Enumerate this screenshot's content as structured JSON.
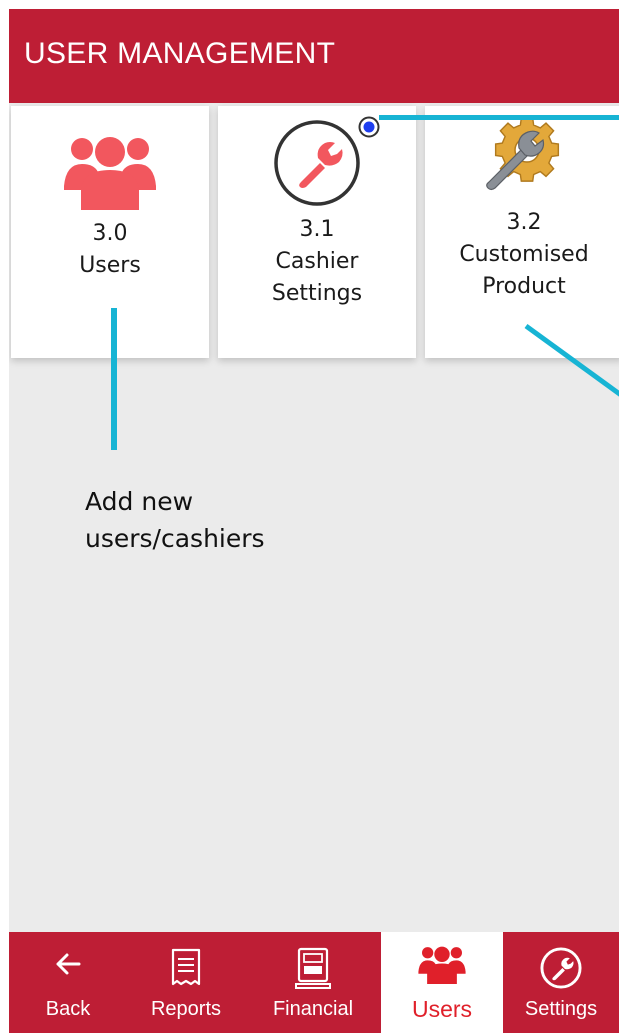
{
  "header": {
    "title": "USER MANAGEMENT",
    "color": "#be1e35"
  },
  "cards": [
    {
      "number": "3.0",
      "label_line1": "Users",
      "label_line2": "",
      "icon": "users-icon"
    },
    {
      "number": "3.1",
      "label_line1": "Cashier",
      "label_line2": "Settings",
      "icon": "wrench-icon"
    },
    {
      "number": "3.2",
      "label_line1": "Customised",
      "label_line2": "Product",
      "icon": "gear-wrench-icon"
    }
  ],
  "annotation": {
    "line1": "Add new",
    "line2": "users/cashiers",
    "line_color": "#17b4d4"
  },
  "bottom_nav": {
    "items": [
      {
        "label": "Back",
        "icon": "back-arrow-icon",
        "active": false
      },
      {
        "label": "Reports",
        "icon": "receipt-icon",
        "active": false
      },
      {
        "label": "Financial",
        "icon": "atm-icon",
        "active": false
      },
      {
        "label": "Users",
        "icon": "users-icon",
        "active": true
      },
      {
        "label": "Settings",
        "icon": "wrench-icon",
        "active": false
      }
    ],
    "background": "#be1e35",
    "active_color": "#e0202a"
  },
  "accent_colors": {
    "icon_red": "#f2575e",
    "screen_background": "#ebebeb"
  }
}
